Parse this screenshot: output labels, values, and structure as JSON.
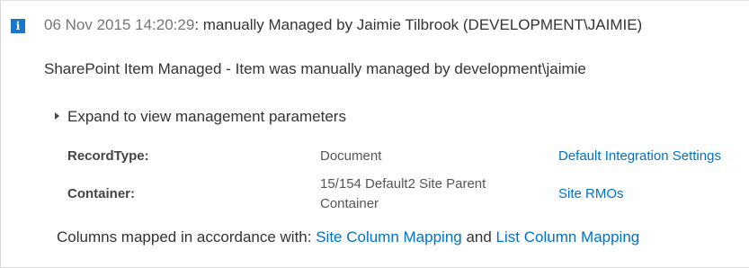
{
  "header": {
    "icon": "info-icon",
    "icon_glyph": "i",
    "timestamp": "06 Nov 2015 14:20:29",
    "text": ": manually Managed by Jaimie Tilbrook (DEVELOPMENT\\JAIMIE)"
  },
  "summary": "SharePoint Item Managed - Item was manually managed by development\\jaimie",
  "expander": {
    "icon": "expand-triangle-icon",
    "label": "Expand to view management parameters"
  },
  "parameters": {
    "record_type": {
      "label": "RecordType:",
      "value": "Document",
      "link": "Default Integration Settings"
    },
    "container": {
      "label": "Container:",
      "value": "15/154 Default2 Site Parent Container",
      "link": "Site RMOs"
    }
  },
  "footer": {
    "prefix": "Columns mapped in accordance with: ",
    "link1": "Site Column Mapping",
    "joiner": " and ",
    "link2": "List Column Mapping"
  },
  "colors": {
    "accent": "#1b75c9",
    "link": "#0072c6"
  }
}
